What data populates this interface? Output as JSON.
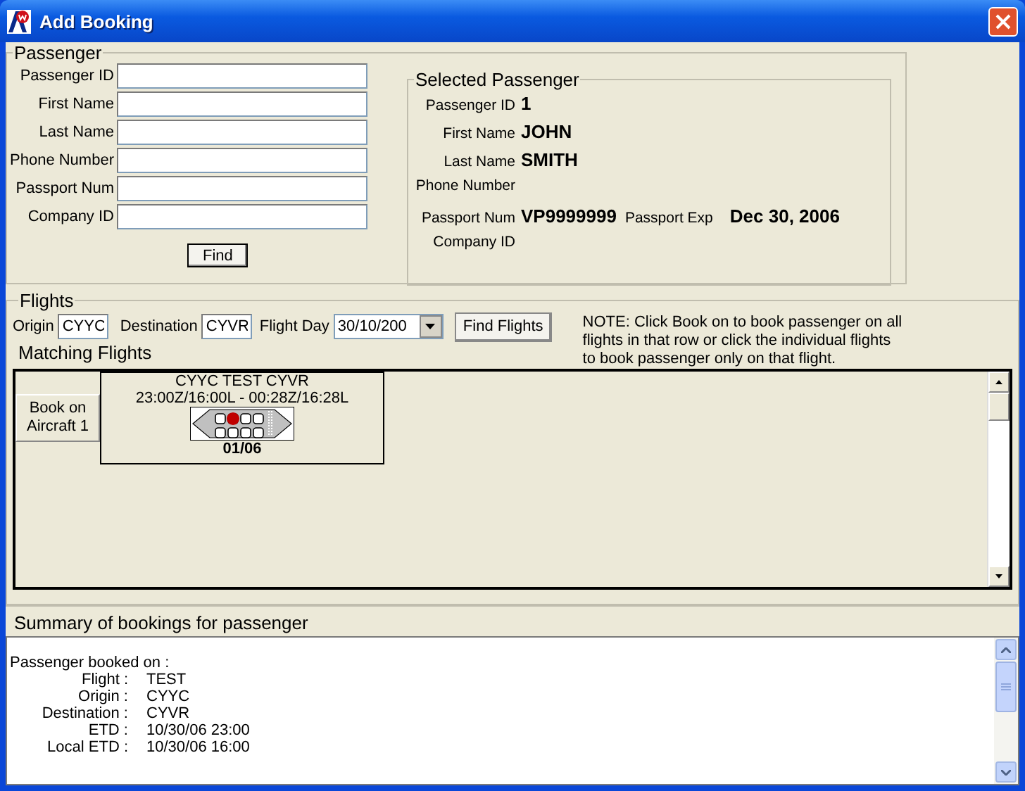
{
  "window": {
    "title": "Add Booking"
  },
  "passenger": {
    "title": "Passenger",
    "fields": [
      {
        "label": "Passenger ID"
      },
      {
        "label": "First Name"
      },
      {
        "label": "Last Name"
      },
      {
        "label": "Phone Number"
      },
      {
        "label": "Passport Num"
      },
      {
        "label": "Company ID"
      }
    ],
    "button": "Find"
  },
  "selected_passenger": {
    "title": "Selected Passenger",
    "rows": [
      {
        "label": "Passenger ID",
        "value": "1"
      },
      {
        "label": "First Name",
        "value": "JOHN"
      },
      {
        "label": "Last Name",
        "value": "SMITH"
      },
      {
        "label": "Phone Number"
      },
      {
        "label": "Passport Num",
        "value": "VP9999999",
        "extra_label": "Passport Exp",
        "extra_value": "Dec 30, 2006"
      },
      {
        "label": "Company ID"
      }
    ]
  },
  "flights": {
    "title": "Flights",
    "origin": {
      "label": "Origin",
      "value": "CYYC"
    },
    "destination": {
      "label": "Destination",
      "value": "CYVR"
    },
    "flight_day": {
      "label": "Flight Day",
      "value": "30/10/200"
    },
    "find_button": "Find Flights",
    "note": "NOTE: Click Book on to book passenger on all flights in that row or click the individual flights to book passenger only on that flight.",
    "matching_label": "Matching Flights",
    "rows": [
      {
        "book_button": "Book on Aircraft 1",
        "flights": [
          {
            "route": "CYYC TEST CYVR",
            "times": "23:00Z/16:00L - 00:28Z/16:28L",
            "date": "01/06"
          }
        ]
      }
    ]
  },
  "summary": {
    "title": "Summary of bookings for passenger",
    "heading": "Passenger booked on :",
    "lines": [
      {
        "label": "Flight :",
        "value": "TEST"
      },
      {
        "label": "Origin :",
        "value": "CYYC"
      },
      {
        "label": "Destination :",
        "value": "CYVR"
      },
      {
        "label": "ETD :",
        "value": "10/30/06 23:00"
      },
      {
        "label": "Local ETD :",
        "value": "10/30/06 16:00"
      }
    ]
  }
}
